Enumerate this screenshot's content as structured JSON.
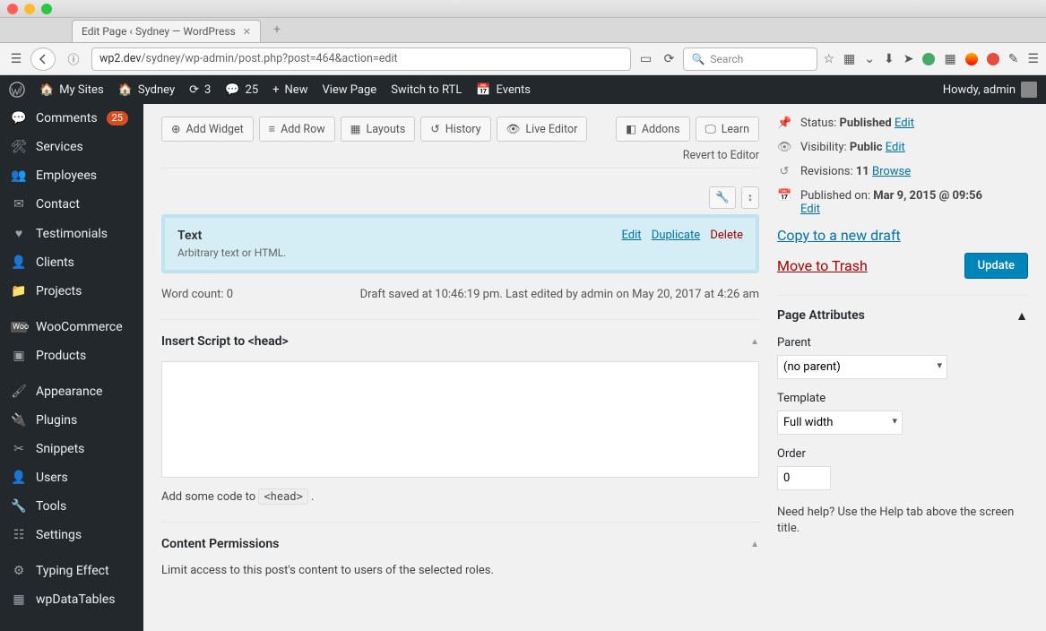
{
  "browser": {
    "tab_title": "Edit Page ‹ Sydney — WordPress",
    "url_prefix": "wp2.dev",
    "url_path": "/sydney/wp-admin/post.php?post=464&action=edit",
    "search_placeholder": "Search"
  },
  "adminbar": {
    "mysites": "My Sites",
    "site": "Sydney",
    "updates": "3",
    "comments": "25",
    "new": "New",
    "view": "View Page",
    "rtl": "Switch to RTL",
    "events": "Events",
    "howdy": "Howdy, admin"
  },
  "sidebar": {
    "items": [
      {
        "icon": "💬",
        "label": "Comments",
        "badge": "25"
      },
      {
        "icon": "🔧",
        "label": "Services"
      },
      {
        "icon": "👥",
        "label": "Employees"
      },
      {
        "icon": "✉",
        "label": "Contact"
      },
      {
        "icon": "♥",
        "label": "Testimonials"
      },
      {
        "icon": "👤",
        "label": "Clients"
      },
      {
        "icon": "📁",
        "label": "Projects"
      },
      {
        "icon": "Woo",
        "label": "WooCommerce"
      },
      {
        "icon": "📦",
        "label": "Products"
      },
      {
        "icon": "🖌",
        "label": "Appearance"
      },
      {
        "icon": "🔌",
        "label": "Plugins"
      },
      {
        "icon": "✂",
        "label": "Snippets"
      },
      {
        "icon": "👤",
        "label": "Users"
      },
      {
        "icon": "🔧",
        "label": "Tools"
      },
      {
        "icon": "⚙",
        "label": "Settings"
      },
      {
        "icon": "⚙",
        "label": "Typing Effect"
      },
      {
        "icon": "▦",
        "label": "wpDataTables"
      }
    ]
  },
  "editor": {
    "buttons": {
      "add_widget": "Add Widget",
      "add_row": "Add Row",
      "layouts": "Layouts",
      "history": "History",
      "live_editor": "Live Editor",
      "addons": "Addons",
      "learn": "Learn"
    },
    "revert": "Revert to Editor",
    "widget": {
      "title": "Text",
      "subtitle": "Arbitrary text or HTML.",
      "edit": "Edit",
      "duplicate": "Duplicate",
      "delete": "Delete"
    },
    "word_count": "Word count: 0",
    "draft_saved": "Draft saved at 10:46:19 pm. Last edited by admin on May 20, 2017 at 4:26 am",
    "insert_head": "Insert Script to <head>",
    "head_hint_pre": "Add some code to ",
    "head_hint_code": "<head>",
    "head_hint_post": " .",
    "content_perm": "Content Permissions",
    "content_perm_desc": "Limit access to this post's content to users of the selected roles."
  },
  "publish": {
    "status_label": "Status: ",
    "status_value": "Published",
    "edit": "Edit",
    "visibility_label": "Visibility: ",
    "visibility_value": "Public",
    "revisions_label": "Revisions: ",
    "revisions_value": "11",
    "browse": "Browse",
    "published_on_label": "Published on: ",
    "published_on_value": "Mar 9, 2015 @ 09:56",
    "copy": "Copy to a new draft",
    "trash": "Move to Trash",
    "update": "Update"
  },
  "attributes": {
    "title": "Page Attributes",
    "parent_label": "Parent",
    "parent_value": "(no parent)",
    "template_label": "Template",
    "template_value": "Full width",
    "order_label": "Order",
    "order_value": "0",
    "help": "Need help? Use the Help tab above the screen title."
  }
}
